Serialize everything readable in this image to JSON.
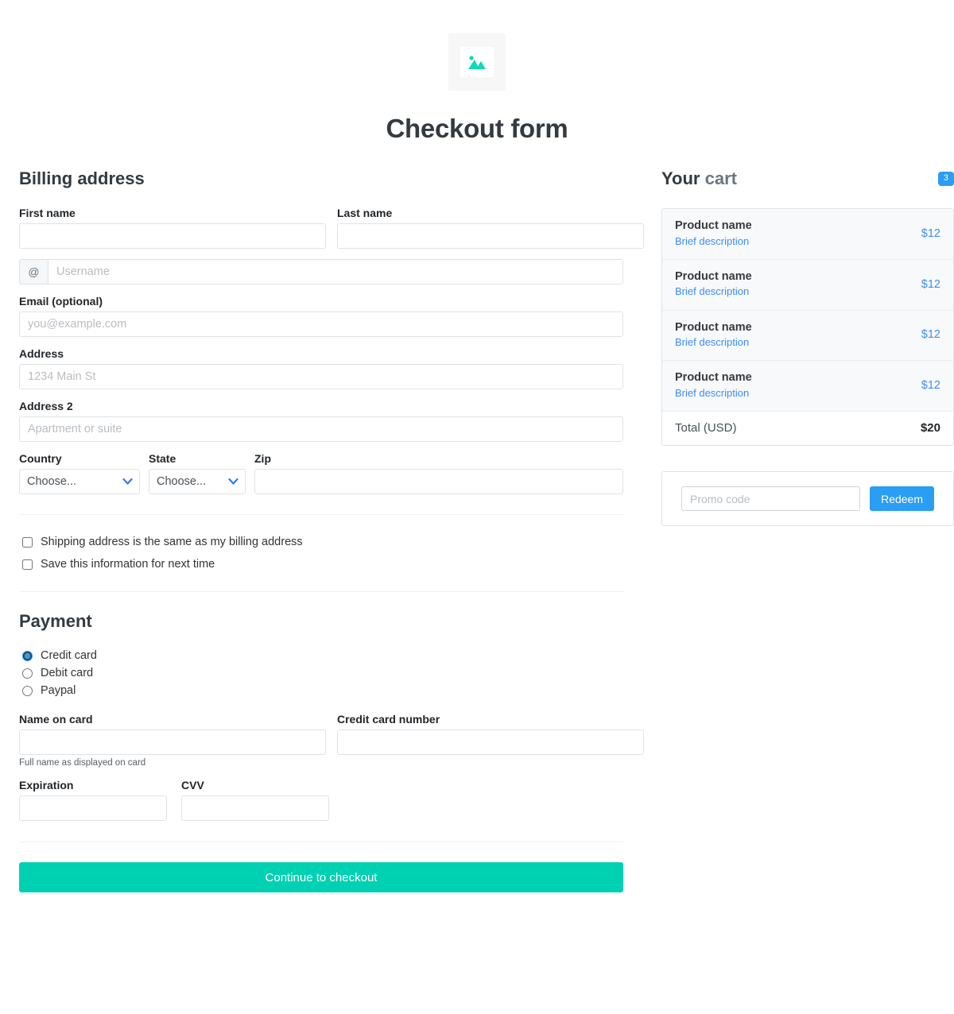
{
  "header": {
    "logo_icon": "image-placeholder-icon",
    "title": "Checkout form"
  },
  "billing": {
    "section_title": "Billing address",
    "first_name_label": "First name",
    "first_name_value": "",
    "last_name_label": "Last name",
    "last_name_value": "",
    "username_addon": "@",
    "username_placeholder": "Username",
    "username_value": "",
    "email_label": "Email (optional)",
    "email_placeholder": "you@example.com",
    "email_value": "",
    "address_label": "Address",
    "address_placeholder": "1234 Main St",
    "address_value": "",
    "address2_label": "Address 2",
    "address2_placeholder": "Apartment or suite",
    "address2_value": "",
    "country_label": "Country",
    "country_selected": "Choose...",
    "state_label": "State",
    "state_selected": "Choose...",
    "zip_label": "Zip",
    "zip_value": "",
    "checkbox_shipping_same": "Shipping address is the same as my billing address",
    "checkbox_save_info": "Save this information for next time"
  },
  "payment": {
    "section_title": "Payment",
    "methods": [
      {
        "label": "Credit card",
        "selected": true
      },
      {
        "label": "Debit card",
        "selected": false
      },
      {
        "label": "Paypal",
        "selected": false
      }
    ],
    "name_on_card_label": "Name on card",
    "name_on_card_value": "",
    "name_on_card_help": "Full name as displayed on card",
    "cc_number_label": "Credit card number",
    "cc_number_value": "",
    "expiration_label": "Expiration",
    "expiration_value": "",
    "cvv_label": "CVV",
    "cvv_value": "",
    "submit_label": "Continue to checkout"
  },
  "cart": {
    "title_main": "Your",
    "title_muted": "cart",
    "badge_count": "3",
    "items": [
      {
        "name": "Product name",
        "description": "Brief description",
        "price": "$12"
      },
      {
        "name": "Product name",
        "description": "Brief description",
        "price": "$12"
      },
      {
        "name": "Product name",
        "description": "Brief description",
        "price": "$12"
      },
      {
        "name": "Product name",
        "description": "Brief description",
        "price": "$12"
      }
    ],
    "total_label": "Total (USD)",
    "total_value": "$20",
    "promo_placeholder": "Promo code",
    "promo_value": "",
    "redeem_label": "Redeem"
  },
  "colors": {
    "accent_teal": "#00d1b2",
    "accent_blue": "#2a9df4",
    "link_blue": "#3c8dff",
    "cart_item_bg": "#f8f9fa",
    "border": "#dee2e6"
  }
}
